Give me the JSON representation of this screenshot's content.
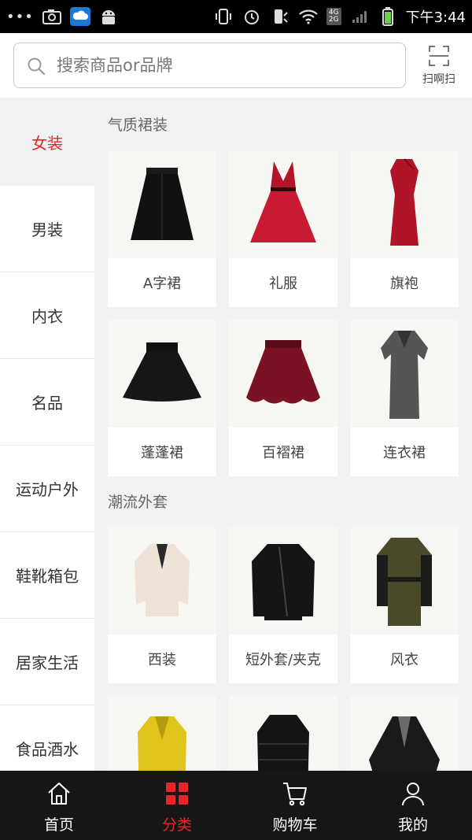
{
  "status_bar": {
    "time": "下午3:44",
    "network_label_top": "4G",
    "network_label_bottom": "2G"
  },
  "search": {
    "placeholder": "搜索商品or品牌",
    "value": ""
  },
  "scan": {
    "label": "扫啊扫",
    "icon": "scan-icon"
  },
  "sidebar": {
    "items": [
      {
        "label": "女装",
        "active": true
      },
      {
        "label": "男装",
        "active": false
      },
      {
        "label": "内衣",
        "active": false
      },
      {
        "label": "名品",
        "active": false
      },
      {
        "label": "运动户外",
        "active": false
      },
      {
        "label": "鞋靴箱包",
        "active": false
      },
      {
        "label": "居家生活",
        "active": false
      },
      {
        "label": "食品酒水",
        "active": false
      }
    ]
  },
  "sections": [
    {
      "title": "气质裙装",
      "items": [
        {
          "label": "A字裙",
          "icon": "a-line-skirt-image"
        },
        {
          "label": "礼服",
          "icon": "evening-dress-image"
        },
        {
          "label": "旗袍",
          "icon": "qipao-image"
        },
        {
          "label": "蓬蓬裙",
          "icon": "puffy-skirt-image"
        },
        {
          "label": "百褶裙",
          "icon": "pleated-skirt-image"
        },
        {
          "label": "连衣裙",
          "icon": "dress-image"
        }
      ]
    },
    {
      "title": "潮流外套",
      "items": [
        {
          "label": "西装",
          "icon": "blazer-image"
        },
        {
          "label": "短外套/夹克",
          "icon": "jacket-image"
        },
        {
          "label": "风衣",
          "icon": "trench-coat-image"
        },
        {
          "label": "",
          "icon": "yellow-coat-image"
        },
        {
          "label": "",
          "icon": "down-jacket-image"
        },
        {
          "label": "",
          "icon": "cape-image"
        }
      ]
    }
  ],
  "tabbar": {
    "items": [
      {
        "label": "首页",
        "icon": "home-icon",
        "active": false
      },
      {
        "label": "分类",
        "icon": "category-icon",
        "active": true
      },
      {
        "label": "购物车",
        "icon": "cart-icon",
        "active": false
      },
      {
        "label": "我的",
        "icon": "user-icon",
        "active": false
      }
    ]
  },
  "colors": {
    "accent": "#e5262b",
    "tabbar_bg": "#161616",
    "status_bg": "#000000"
  }
}
